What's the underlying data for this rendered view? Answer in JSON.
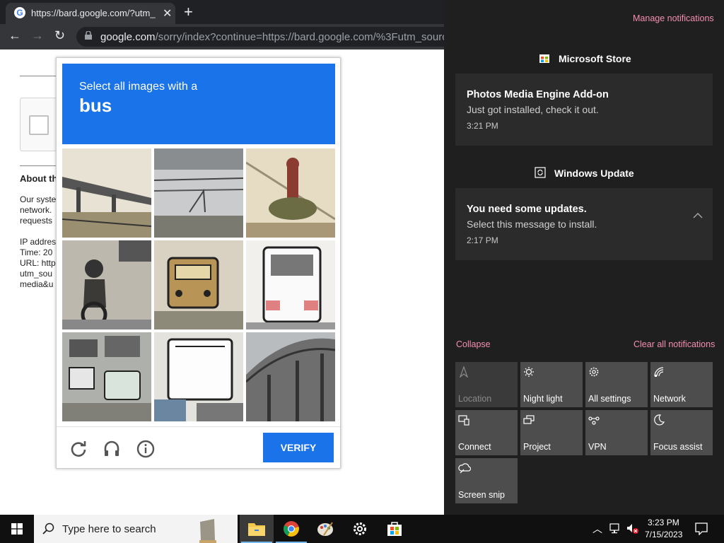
{
  "browser": {
    "tab_title": "https://bard.google.com/?utm_so",
    "url_host": "google.com",
    "url_path": "/sorry/index?continue=https://bard.google.com/%3Futm_source%3"
  },
  "page_fragments": {
    "about": "About th",
    "lines": [
      "Our syste",
      "network.",
      "requests",
      "IP addres",
      "Time: 20",
      "URL: http",
      "utm_sou",
      "media&u"
    ]
  },
  "captcha": {
    "instruction": "Select all images with a",
    "target": "bus",
    "verify_label": "VERIFY",
    "colors": {
      "header": "#1a73e8"
    }
  },
  "action_center": {
    "manage_notifications": "Manage notifications",
    "groups": [
      {
        "app": "Microsoft Store",
        "title": "Photos Media Engine Add-on",
        "body": "Just got installed, check it out.",
        "time": "3:21 PM"
      },
      {
        "app": "Windows Update",
        "title": "You need some updates.",
        "body": "Select this message to install.",
        "time": "2:17 PM"
      }
    ],
    "collapse": "Collapse",
    "clear_all": "Clear all notifications",
    "quick_actions": [
      "Location",
      "Night light",
      "All settings",
      "Network",
      "Connect",
      "Project",
      "VPN",
      "Focus assist",
      "Screen snip"
    ]
  },
  "taskbar": {
    "search_placeholder": "Type here to search",
    "time": "3:23 PM",
    "date": "7/15/2023"
  }
}
